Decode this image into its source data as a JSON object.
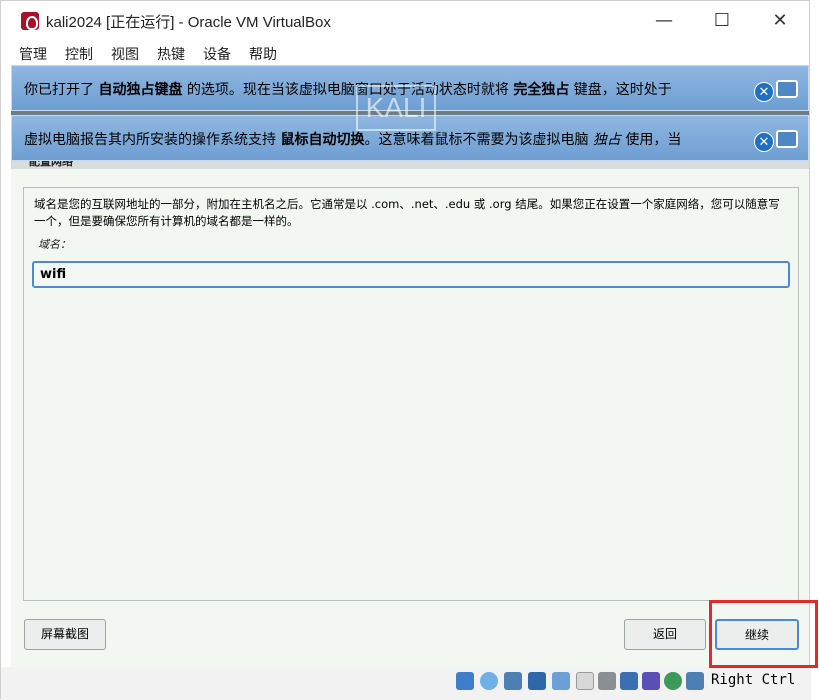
{
  "window": {
    "title": "kali2024 [正在运行] - Oracle VM VirtualBox",
    "minimize_glyph": "—",
    "maximize_glyph": "☐",
    "close_glyph": "✕"
  },
  "menu": {
    "items": [
      "管理",
      "控制",
      "视图",
      "热键",
      "设备",
      "帮助"
    ]
  },
  "notices": [
    {
      "parts": [
        "你已打开了 ",
        "自动独占键盘",
        " 的选项。现在当该虚拟电脑窗口处于活动状态时就将 ",
        "完全独占",
        " 键盘，这时处于"
      ]
    },
    {
      "parts": [
        "虚拟电脑报告其内所安装的操作系统支持 ",
        "鼠标自动切换",
        "。这意味着鼠标不需要为该虚拟电脑 ",
        "独占",
        " 使用，当"
      ]
    }
  ],
  "watermark": "KALI",
  "installer": {
    "section_title": "配置网络",
    "description": "域名是您的互联网地址的一部分，附加在主机名之后。它通常是以 .com、.net、.edu 或 .org 结尾。如果您正在设置一个家庭网络，您可以随意写一个，但是要确保您所有计算机的域名都是一样的。",
    "field_label": "域名：",
    "domain_value": "wifi",
    "screenshot_button": "屏幕截图",
    "back_button": "返回",
    "continue_button": "继续"
  },
  "statusbar": {
    "host_key": "Right Ctrl",
    "icons": [
      "disk-icon",
      "optical-icon",
      "audio-icon",
      "network-icon",
      "usb-icon",
      "shared-folder-icon",
      "display-icon",
      "capture-icon",
      "cpu-icon",
      "mouse-integration-icon",
      "keyboard-icon"
    ]
  },
  "colors": {
    "accent": "#4a8bd6",
    "highlight": "#e32a2a",
    "installer_bg": "#f2f7f2"
  }
}
